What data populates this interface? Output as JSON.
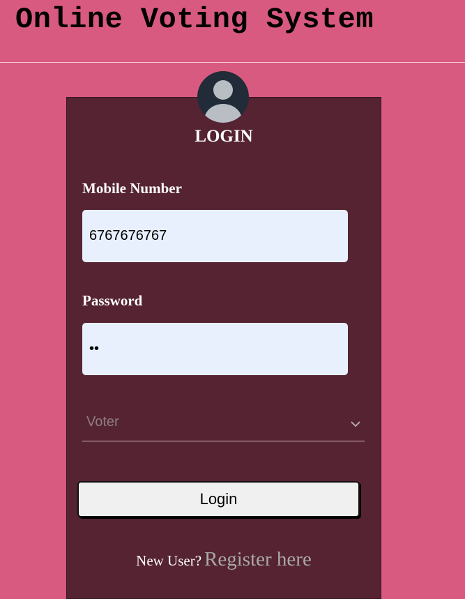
{
  "header": {
    "title": "Online Voting System"
  },
  "login_card": {
    "title": "LOGIN",
    "avatar_icon": "user-avatar-icon",
    "mobile": {
      "label": "Mobile Number",
      "value": "6767676767"
    },
    "password": {
      "label": "Password",
      "value": "ab"
    },
    "role_select": {
      "selected": "Voter",
      "icon": "chevron-down-icon"
    },
    "login_button": "Login",
    "register": {
      "prompt": "New User?",
      "link_text": "Register here"
    }
  },
  "colors": {
    "page_background": "#d95a80",
    "card_background": "#552332",
    "input_background": "#e8f0fe",
    "link": "#a9a9a9"
  }
}
